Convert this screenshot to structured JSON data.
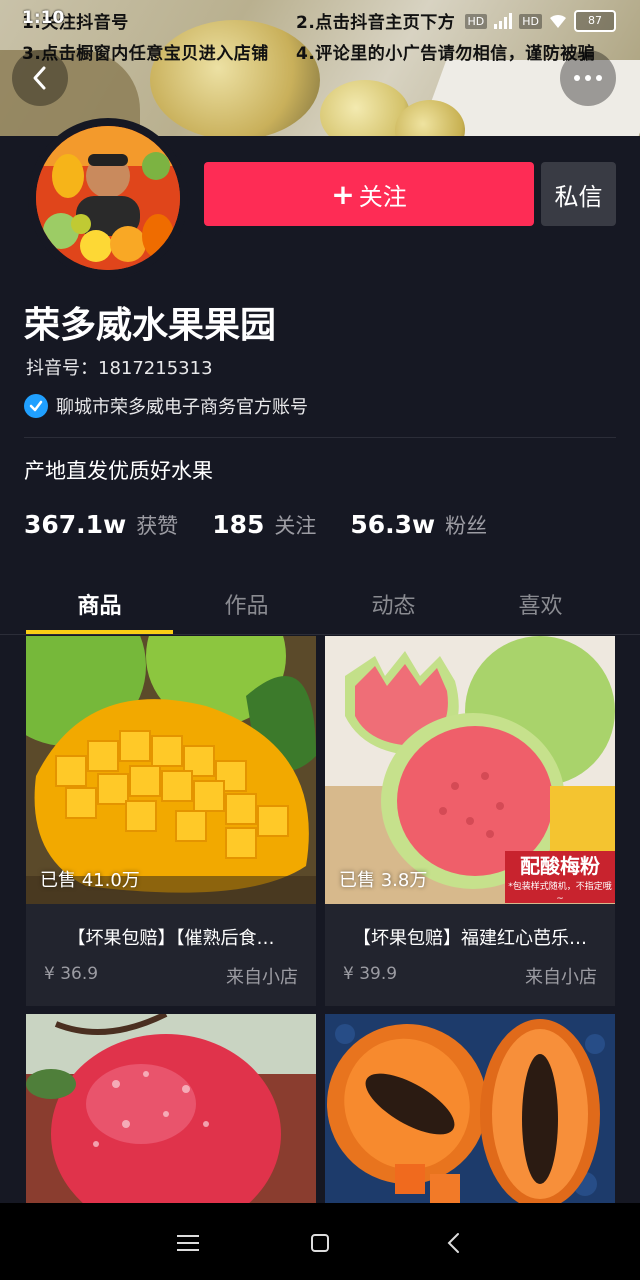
{
  "status": {
    "time": "1:10",
    "battery": "87",
    "sig1": "HD",
    "sig2": "HD"
  },
  "banner": {
    "line1_left": "1.关注抖音号",
    "line1_right": "2.点击抖音主页下方",
    "line2_left": "3.点击橱窗内任意宝贝进入店铺",
    "line2_right": "4.评论里的小广告请勿相信，谨防被骗"
  },
  "profile": {
    "follow_label": "关注",
    "message_label": "私信",
    "name": "荣多威水果果园",
    "douyin_id": "抖音号：1817215313",
    "verified_text": "聊城市荣多威电子商务官方账号",
    "bio": "产地直发优质好水果",
    "stats": [
      {
        "num": "367.1w",
        "label": "获赞"
      },
      {
        "num": "185",
        "label": "关注"
      },
      {
        "num": "56.3w",
        "label": "粉丝"
      }
    ]
  },
  "tabs": [
    "商品",
    "作品",
    "动态",
    "喜欢"
  ],
  "active_tab": 0,
  "products": [
    {
      "sold": "已售 41.0万",
      "title": "【坏果包赔】【催熟后食…",
      "price": "¥ 36.9",
      "shop": "来自小店"
    },
    {
      "sold": "已售 3.8万",
      "title": "【坏果包赔】福建红心芭乐…",
      "price": "¥ 39.9",
      "shop": "来自小店",
      "promo": "配酸梅粉",
      "promo_note": "*包装样式随机，不指定哦~"
    }
  ],
  "colors": {
    "background": "#161823",
    "follow": "#fe2c55",
    "tab_indicator": "#face15",
    "verify": "#20a0ff"
  }
}
